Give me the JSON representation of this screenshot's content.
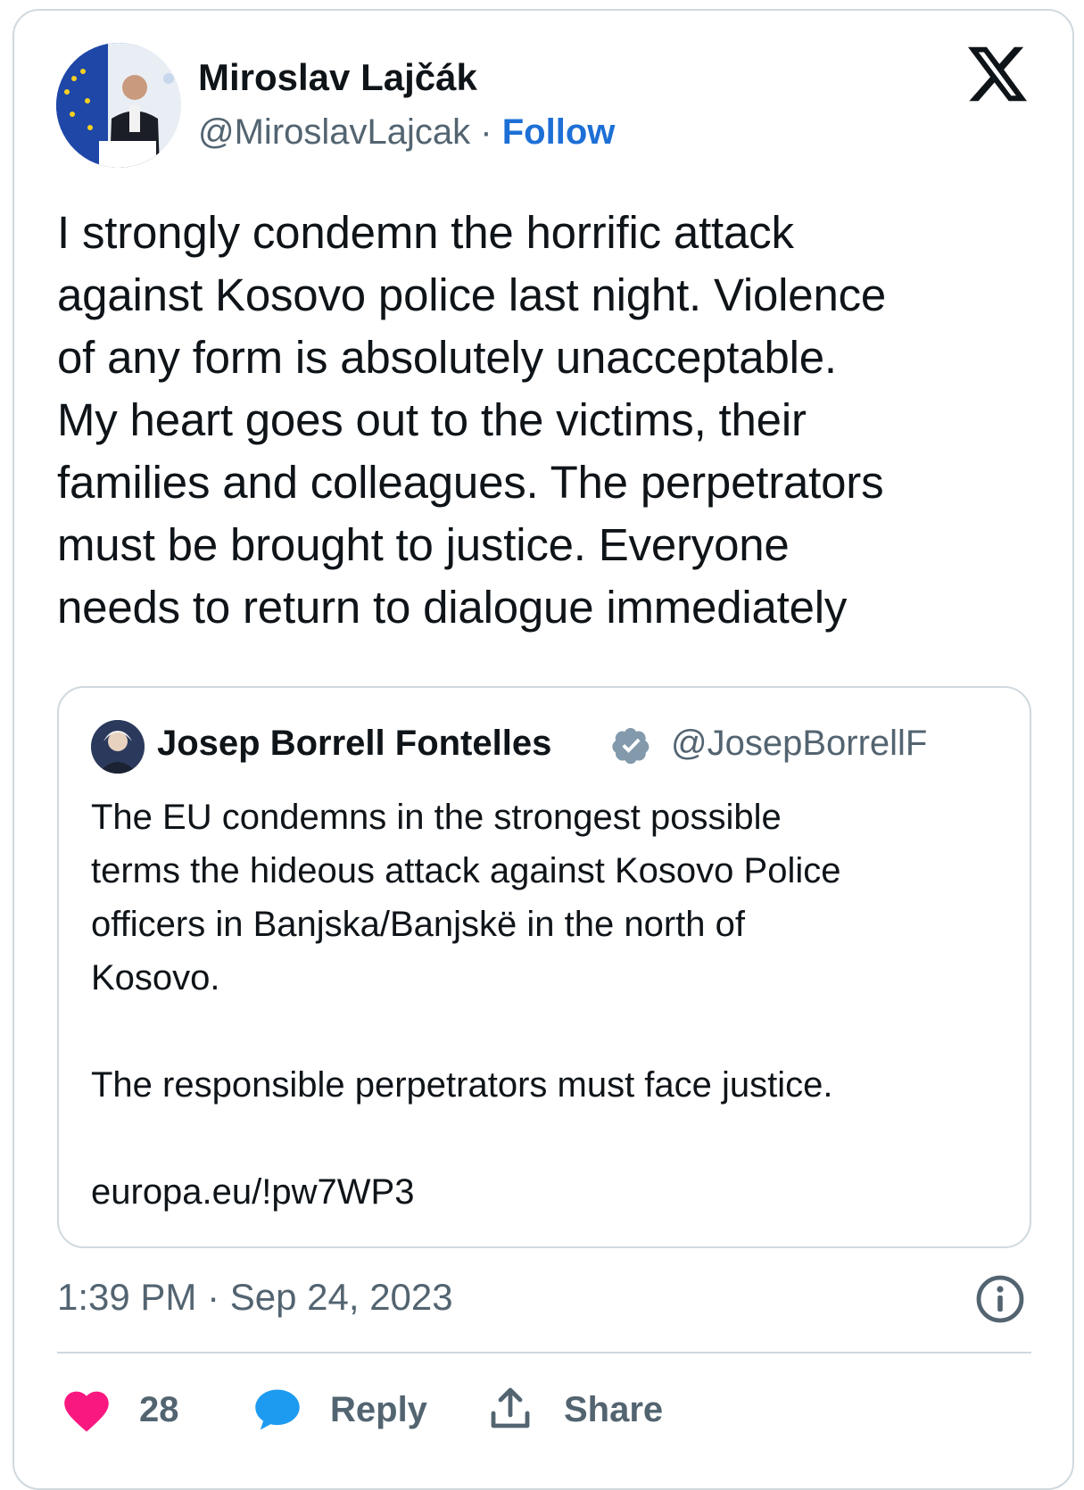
{
  "author": {
    "name": "Miroslav Lajčák",
    "handle": "@MiroslavLajcak",
    "separator": "·",
    "follow_label": "Follow"
  },
  "tweet": {
    "text": "I strongly condemn the horrific attack\nagainst Kosovo police last night. Violence\nof any form is absolutely unacceptable.\nMy heart goes out to the victims, their\nfamilies and colleagues. The perpetrators\nmust be brought to justice. Everyone\nneeds to return to dialogue immediately"
  },
  "quoted_tweet": {
    "name": "Josep Borrell Fontelles",
    "handle": "@JosepBorrellF",
    "text": "The EU condemns in the strongest possible\nterms the hideous attack against Kosovo Police\nofficers in Banjska/Banjskë in the north of\nKosovo.\n\nThe responsible perpetrators must face justice.\n\neuropa.eu/!pw7WP3"
  },
  "meta": {
    "timestamp": "1:39 PM · Sep 24, 2023"
  },
  "actions": {
    "like_count": "28",
    "reply_label": "Reply",
    "share_label": "Share"
  },
  "icons": {
    "platform": "x-logo-icon",
    "verified": "verified-badge-icon",
    "info": "info-icon",
    "like": "heart-icon",
    "reply": "speech-bubble-icon",
    "share": "share-upload-icon"
  },
  "colors": {
    "follow": "#1d6fd6",
    "like": "#f91880",
    "reply": "#1d9bf0",
    "secondary_text": "#536471",
    "border": "#cfd9de"
  }
}
